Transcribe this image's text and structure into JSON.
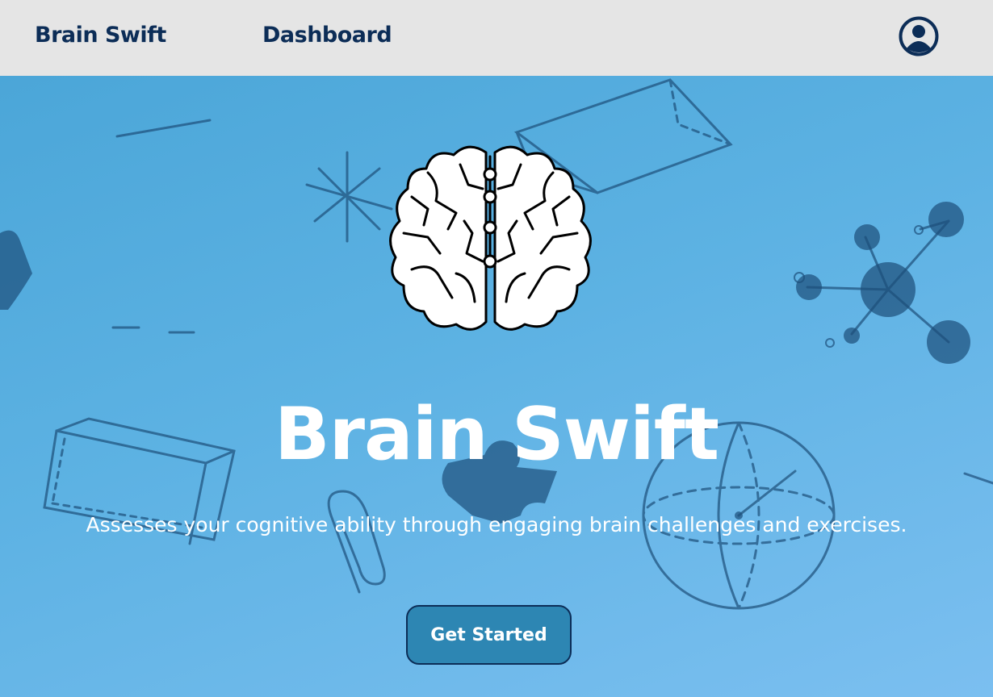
{
  "nav": {
    "brand": "Brain Swift",
    "dashboard_label": "Dashboard",
    "profile_icon": "user-circle-icon"
  },
  "hero": {
    "title": "Brain Swift",
    "subtitle": "Assesses your cognitive ability through engaging brain challenges and exercises.",
    "cta_label": "Get Started",
    "logo_icon": "brain-icon"
  },
  "colors": {
    "nav_background": "#e5e5e5",
    "nav_text": "#0c2d57",
    "hero_gradient_start": "#4ba6d8",
    "hero_gradient_end": "#7bbff0",
    "button_background": "#2d86b3",
    "button_border": "#0c2d57",
    "doodle": "#1d4f7a"
  }
}
